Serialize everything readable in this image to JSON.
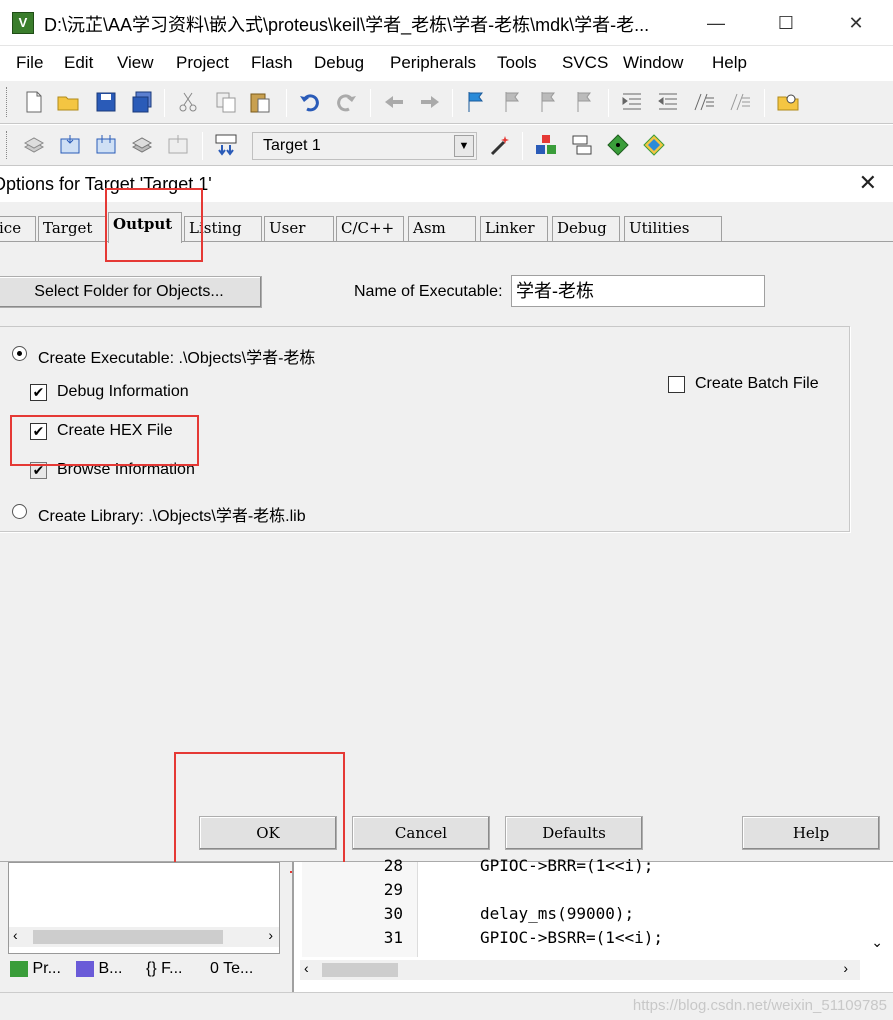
{
  "window": {
    "title": "D:\\沅芷\\AA学习资料\\嵌入式\\proteus\\keil\\学者_老栋\\学者-老栋\\mdk\\学者-老...",
    "app_icon_letter": "V",
    "minimize": "—",
    "maximize": "☐",
    "close": "✕"
  },
  "menu": [
    "File",
    "Edit",
    "View",
    "Project",
    "Flash",
    "Debug",
    "Peripherals",
    "Tools",
    "SVCS",
    "Window",
    "Help"
  ],
  "toolbar2": {
    "target_label": "Target 1"
  },
  "dialog": {
    "title": "Options for Target 'Target 1'",
    "close": "✕",
    "tabs": [
      "ice",
      "Target",
      "Output",
      "Listing",
      "User",
      "C/C++",
      "Asm",
      "Linker",
      "Debug",
      "Utilities"
    ],
    "active_tab": "Output",
    "select_folder_button": "Select Folder for Objects...",
    "name_exec_label": "Name of Executable:",
    "name_exec_value": "学者-老栋",
    "create_executable_label": "Create Executable:  .\\Objects\\学者-老栋",
    "debug_info_label": "Debug Information",
    "create_hex_label": "Create HEX File",
    "browse_info_label": "Browse Information",
    "create_library_label": "Create Library:  .\\Objects\\学者-老栋.lib",
    "create_batch_label": "Create Batch File",
    "ok": "OK",
    "cancel": "Cancel",
    "defaults": "Defaults",
    "help": "Help"
  },
  "project_tabs": [
    "Pr...",
    "B...",
    "F...",
    "Te..."
  ],
  "editor": {
    "lines": [
      {
        "num": "28",
        "code": "GPIOC->BRR=(1<<i);"
      },
      {
        "num": "29",
        "code": ""
      },
      {
        "num": "30",
        "code": "delay_ms(99000);"
      },
      {
        "num": "31",
        "code": "GPIOC->BSRR=(1<<i);"
      }
    ]
  },
  "watermark": "https://blog.csdn.net/weixin_51109785"
}
